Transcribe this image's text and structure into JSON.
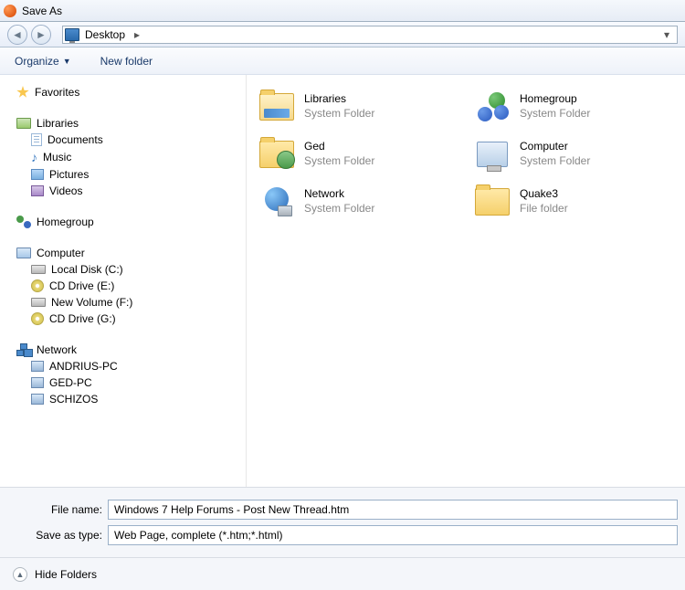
{
  "title": "Save As",
  "breadcrumb": {
    "location": "Desktop"
  },
  "toolbar": {
    "organize": "Organize",
    "new_folder": "New folder"
  },
  "sidebar": {
    "favorites": {
      "label": "Favorites"
    },
    "libraries": {
      "label": "Libraries",
      "items": [
        {
          "label": "Documents"
        },
        {
          "label": "Music"
        },
        {
          "label": "Pictures"
        },
        {
          "label": "Videos"
        }
      ]
    },
    "homegroup": {
      "label": "Homegroup"
    },
    "computer": {
      "label": "Computer",
      "items": [
        {
          "label": "Local Disk (C:)"
        },
        {
          "label": "CD Drive (E:)"
        },
        {
          "label": "New Volume (F:)"
        },
        {
          "label": "CD Drive (G:)"
        }
      ]
    },
    "network": {
      "label": "Network",
      "items": [
        {
          "label": "ANDRIUS-PC"
        },
        {
          "label": "GED-PC"
        },
        {
          "label": "SCHIZOS"
        }
      ]
    }
  },
  "content": [
    {
      "name": "Libraries",
      "sub": "System Folder",
      "icon": "libraries"
    },
    {
      "name": "Homegroup",
      "sub": "System Folder",
      "icon": "homegroup"
    },
    {
      "name": "Ged",
      "sub": "System Folder",
      "icon": "user"
    },
    {
      "name": "Computer",
      "sub": "System Folder",
      "icon": "computer"
    },
    {
      "name": "Network",
      "sub": "System Folder",
      "icon": "network"
    },
    {
      "name": "Quake3",
      "sub": "File folder",
      "icon": "folder"
    }
  ],
  "fields": {
    "filename_label": "File name:",
    "filename_value": "Windows 7 Help Forums - Post New Thread.htm",
    "savetype_label": "Save as type:",
    "savetype_value": "Web Page, complete (*.htm;*.html)"
  },
  "footer": {
    "hide_folders": "Hide Folders"
  }
}
